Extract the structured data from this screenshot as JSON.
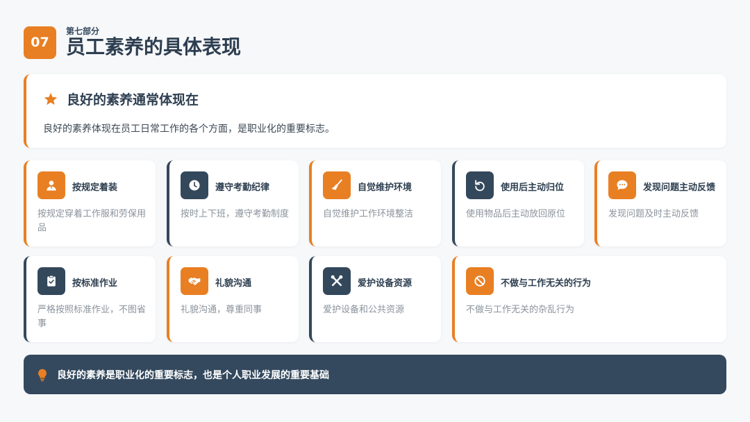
{
  "header": {
    "number": "07",
    "section_label": "第七部分",
    "title": "员工素养的具体表现"
  },
  "intro": {
    "icon": "star-icon",
    "title": "良好的素养通常体现在",
    "description": "良好的素养体现在员工日常工作的各个方面，是职业化的重要标志。"
  },
  "cards": [
    {
      "icon": "person-icon",
      "title": "按规定着装",
      "desc": "按规定穿着工作服和劳保用品"
    },
    {
      "icon": "clock-icon",
      "title": "遵守考勤纪律",
      "desc": "按时上下班，遵守考勤制度"
    },
    {
      "icon": "broom-icon",
      "title": "自觉维护环境",
      "desc": "自觉维护工作环境整洁"
    },
    {
      "icon": "undo-icon",
      "title": "使用后主动归位",
      "desc": "使用物品后主动放回原位"
    },
    {
      "icon": "chat-icon",
      "title": "发现问题主动反馈",
      "desc": "发现问题及时主动反馈"
    },
    {
      "icon": "clipboard-icon",
      "title": "按标准作业",
      "desc": "严格按照标准作业，不图省事"
    },
    {
      "icon": "handshake-icon",
      "title": "礼貌沟通",
      "desc": "礼貌沟通，尊重同事"
    },
    {
      "icon": "tools-icon",
      "title": "爱护设备资源",
      "desc": "爱护设备和公共资源"
    },
    {
      "icon": "ban-icon",
      "title": "不做与工作无关的行为",
      "desc": "不做与工作无关的杂乱行为"
    }
  ],
  "footer": {
    "icon": "lightbulb-icon",
    "text": "良好的素养是职业化的重要标志，也是个人职业发展的重要基础"
  },
  "colors": {
    "accent": "#e87f23",
    "navy": "#34485c",
    "background": "#f7f8fa"
  }
}
